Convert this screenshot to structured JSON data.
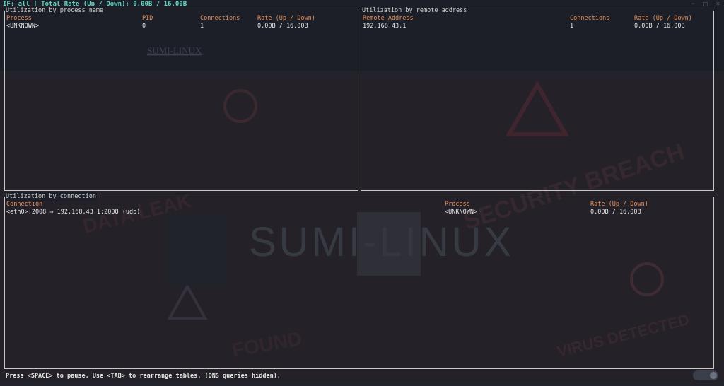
{
  "status": {
    "interface": "IF: all",
    "rate_label": "Total Rate (Up / Down):",
    "rate_value": "0.00B / 16.00B"
  },
  "process_panel": {
    "title": "Utilization by process name",
    "headers": [
      "Process",
      "PID",
      "Connections",
      "Rate (Up / Down)"
    ],
    "rows": [
      [
        "<UNKNOWN>",
        "0",
        "1",
        "0.00B / 16.00B"
      ]
    ]
  },
  "remote_panel": {
    "title": "Utilization by remote address",
    "headers": [
      "Remote Address",
      "Connections",
      "Rate (Up / Down)"
    ],
    "rows": [
      [
        "192.168.43.1",
        "1",
        "0.00B / 16.00B"
      ]
    ]
  },
  "connection_panel": {
    "title": "Utilization by connection",
    "headers": [
      "Connection",
      "Process",
      "Rate (Up / Down)"
    ],
    "rows": [
      [
        "<eth0>:2008 ⇒ 192.168.43.1:2008 (udp)",
        "<UNKNOWN>",
        "0.00B / 16.00B"
      ]
    ]
  },
  "footer": "Press <SPACE> to pause. Use <TAB> to rearrange tables. (DNS queries hidden).",
  "wallpaper": {
    "brand": "SUMI-LINUX",
    "small_brand": "SUMI-LINUX",
    "words": [
      "SECURITY BREACH",
      "VIRUS DETECTED",
      "DATA LEAK",
      "FOUND"
    ]
  },
  "colors": {
    "background": "#1c1f27",
    "header": "#e8915a",
    "status": "#5fd7c4",
    "border": "#c8c8c8"
  }
}
